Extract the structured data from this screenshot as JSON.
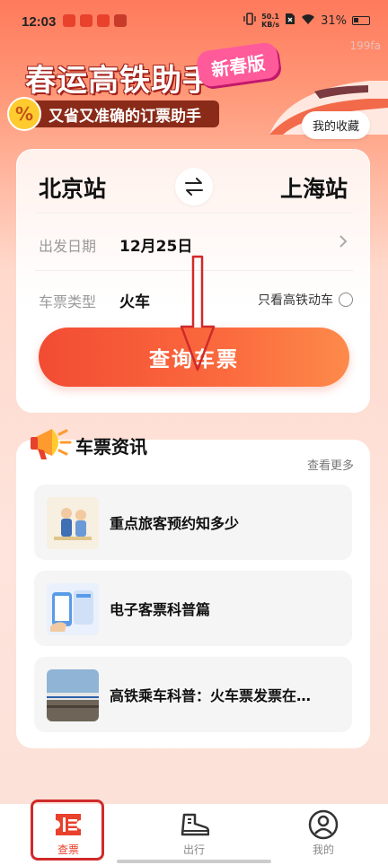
{
  "status_bar": {
    "time": "12:03",
    "net_speed_value": "50.1",
    "net_speed_unit": "KB/s",
    "battery": "31%"
  },
  "header": {
    "title": "春运高铁助手",
    "badge": "新春版",
    "subtitle": "又省又准确的订票助手",
    "percent_symbol": "%",
    "watermark": "199fa",
    "favorites_button": "我的收藏"
  },
  "search": {
    "from_station": "北京站",
    "to_station": "上海站",
    "date_label": "出发日期",
    "date_value": "12月25日",
    "type_label": "车票类型",
    "type_value": "火车",
    "highspeed_only_label": "只看高铁动车",
    "highspeed_only_checked": false,
    "query_button": "查询车票"
  },
  "news": {
    "title": "车票资讯",
    "more_link": "查看更多",
    "items": [
      {
        "text": "重点旅客预约知多少",
        "thumb": "travelers-illustration"
      },
      {
        "text": "电子客票科普篇",
        "thumb": "phone-ticket-illustration"
      },
      {
        "text": "高铁乘车科普：火车票发票在…",
        "thumb": "train-photo"
      }
    ]
  },
  "bottom_nav": {
    "items": [
      {
        "label": "查票",
        "icon": "ticket-icon",
        "active": true
      },
      {
        "label": "出行",
        "icon": "shoe-icon",
        "active": false
      },
      {
        "label": "我的",
        "icon": "profile-icon",
        "active": false
      }
    ]
  },
  "colors": {
    "accent": "#f24c33",
    "highlight_box": "#d02a2a"
  }
}
